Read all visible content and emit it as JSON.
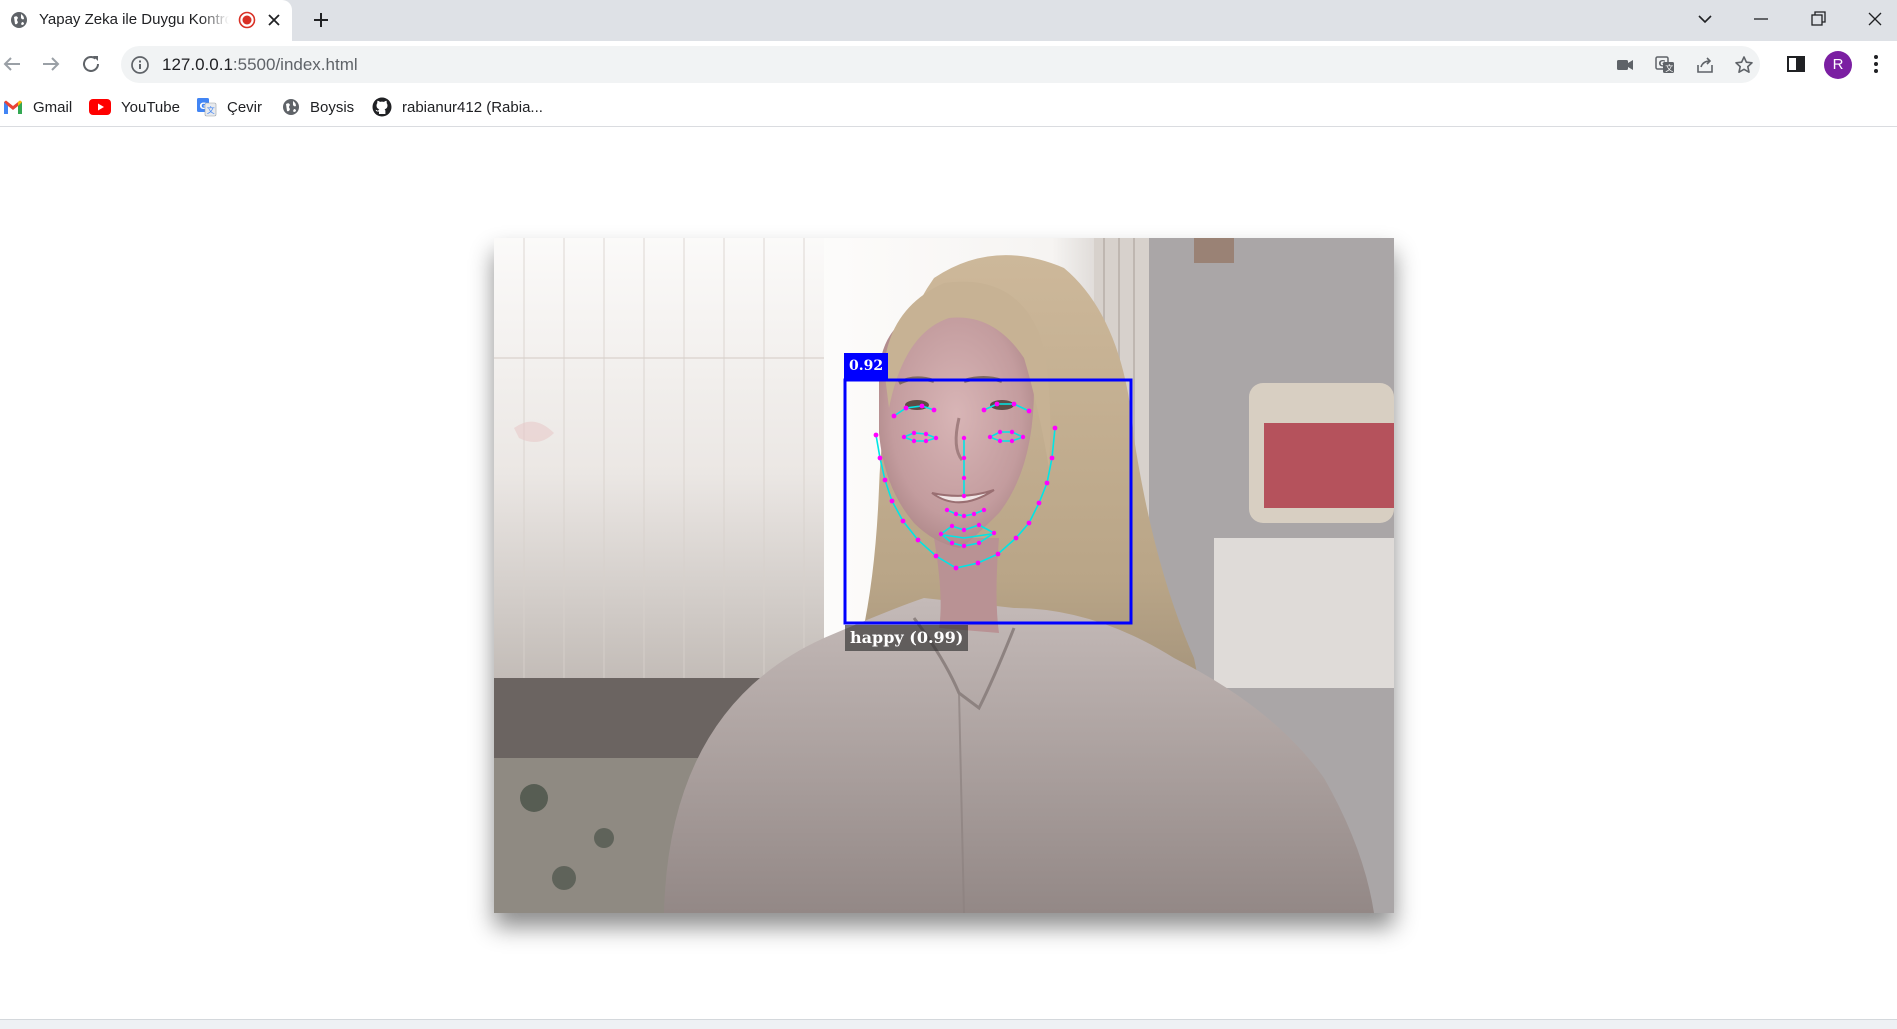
{
  "browser": {
    "tab": {
      "title": "Yapay Zeka ile Duygu Kontrolü",
      "favicon": "globe-icon",
      "recording_icon": "recording-icon",
      "close_icon": "close-icon"
    },
    "new_tab_icon": "plus-icon",
    "window_controls": [
      "tab-search-icon",
      "minimize-icon",
      "restore-icon",
      "close-window-icon"
    ],
    "address_bar": {
      "host": "127.0.0.1",
      "path": ":5500/index.html",
      "info_icon": "info-icon",
      "right_icons": [
        "camera-in-use-icon",
        "translate-icon",
        "share-icon",
        "bookmark-star-icon"
      ]
    },
    "profile_initial": "R",
    "bookmarks": [
      {
        "label": "Gmail",
        "icon": "gmail-icon"
      },
      {
        "label": "YouTube",
        "icon": "youtube-icon"
      },
      {
        "label": "Çevir",
        "icon": "google-translate-icon"
      },
      {
        "label": "Boysis",
        "icon": "globe-icon"
      },
      {
        "label": "rabianur412 (Rabia...",
        "icon": "github-icon"
      }
    ]
  },
  "detection": {
    "score": "0.92",
    "expression": "happy (0.99)",
    "box_color": "#0000ff",
    "landmark_color": "#ff00ff",
    "outline_color": "#00e5e5"
  }
}
